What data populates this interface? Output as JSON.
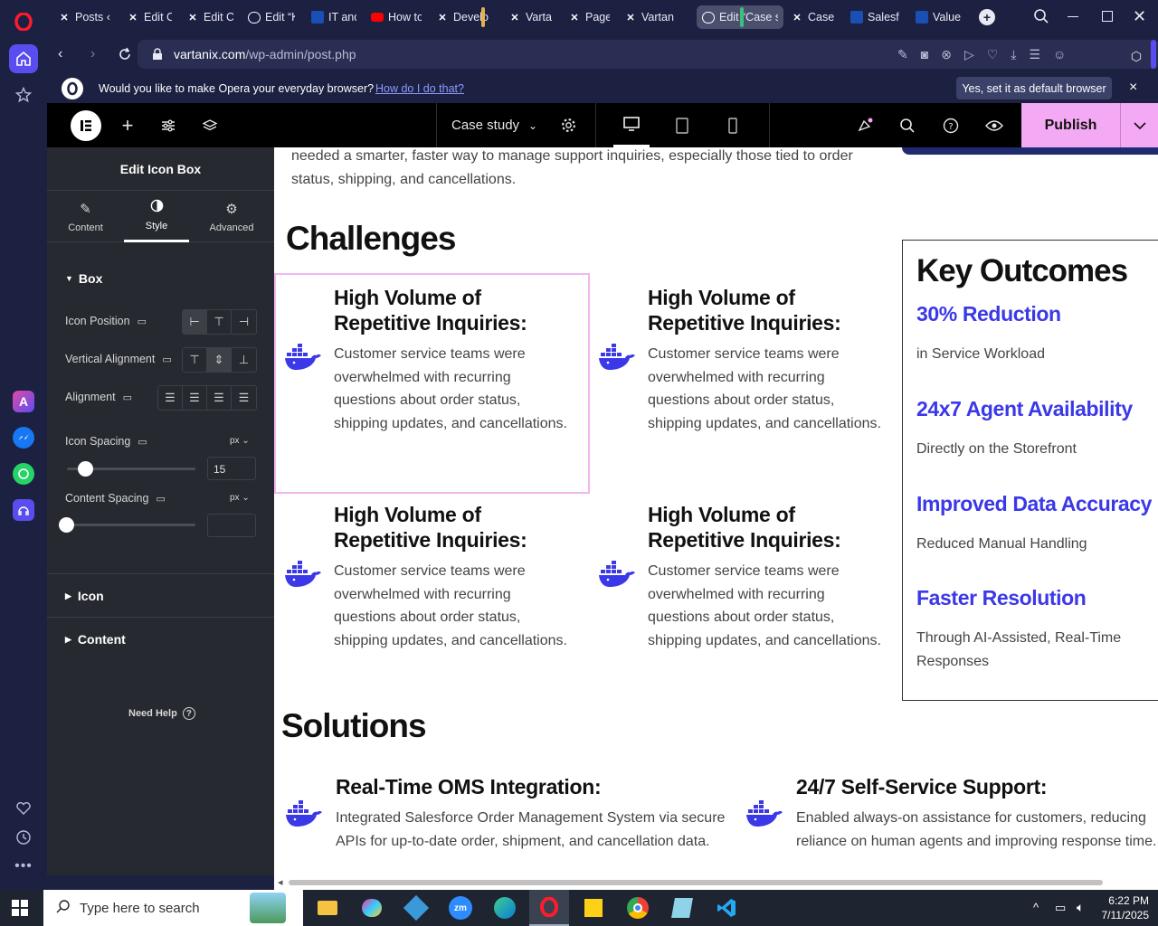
{
  "browser": {
    "tabs": [
      {
        "title": "Posts ‹",
        "icon": "x"
      },
      {
        "title": "Edit Co",
        "icon": "x"
      },
      {
        "title": "Edit Co",
        "icon": "x"
      },
      {
        "title": "Edit “K",
        "icon": "wp"
      },
      {
        "title": "IT and",
        "icon": "doc"
      },
      {
        "title": "How to",
        "icon": "yt"
      },
      {
        "title": "Develo",
        "icon": "x"
      },
      {
        "title": "Vartan",
        "icon": "x"
      },
      {
        "title": "Pages",
        "icon": "x"
      },
      {
        "title": "Vartan",
        "icon": "x"
      },
      {
        "title": "Edit “Case st",
        "icon": "wp"
      },
      {
        "title": "Case st",
        "icon": "x"
      },
      {
        "title": "Salesfo",
        "icon": "doc"
      },
      {
        "title": "Value c",
        "icon": "doc"
      }
    ],
    "url_domain": "vartanix.com",
    "url_path": "/wp-admin/post.php",
    "infobar": {
      "message": "Would you like to make Opera your everyday browser?",
      "link": "How do I do that?",
      "button": "Yes, set it as default browser",
      "close": "×"
    }
  },
  "elementor": {
    "document_title": "Case study",
    "publish_label": "Publish"
  },
  "panel": {
    "title": "Edit Icon Box",
    "tabs": [
      {
        "label": "Content",
        "icon": "pencil-icon"
      },
      {
        "label": "Style",
        "icon": "contrast-icon"
      },
      {
        "label": "Advanced",
        "icon": "gear-icon"
      }
    ],
    "active_tab": "Style",
    "section_box": "Box",
    "icon_position_label": "Icon Position",
    "vertical_alignment_label": "Vertical Alignment",
    "alignment_label": "Alignment",
    "icon_spacing_label": "Icon Spacing",
    "icon_spacing_unit": "px",
    "icon_spacing_value": "15",
    "content_spacing_label": "Content Spacing",
    "content_spacing_unit": "px",
    "content_spacing_value": "",
    "section_icon": "Icon",
    "section_content": "Content",
    "need_help": "Need Help"
  },
  "canvas": {
    "intro_text_line1": "needed a smarter, faster way to manage support inquiries, especially those tied to order",
    "intro_text_line2": "status, shipping, and cancellations.",
    "challenges_heading": "Challenges",
    "challenges": [
      {
        "title": "High Volume of Repetitive Inquiries:",
        "text": "Customer service teams were overwhelmed with recurring questions about order status, shipping updates, and cancellations."
      },
      {
        "title": "High Volume of Repetitive Inquiries:",
        "text": "Customer service teams were overwhelmed with recurring questions about order status, shipping updates, and cancellations."
      },
      {
        "title": "High Volume of Repetitive Inquiries:",
        "text": "Customer service teams were overwhelmed with recurring questions about order status, shipping updates, and cancellations."
      },
      {
        "title": "High Volume of Repetitive Inquiries:",
        "text": "Customer service teams were overwhelmed with recurring questions about order status, shipping updates, and cancellations."
      }
    ],
    "key_outcomes": {
      "heading": "Key Outcomes",
      "items": [
        {
          "title": "30% Reduction",
          "text": "in Service Workload"
        },
        {
          "title": "24x7 Agent Availability",
          "text": "Directly on the Storefront"
        },
        {
          "title": "Improved Data Accuracy",
          "text": "Reduced Manual Handling"
        },
        {
          "title": "Faster Resolution",
          "text": "Through AI-Assisted, Real-Time Responses"
        }
      ]
    },
    "solutions_heading": "Solutions",
    "solutions": [
      {
        "title": "Real-Time OMS Integration:",
        "text": "Integrated Salesforce Order Management System via secure APIs for up-to-date order, shipment, and cancellation data."
      },
      {
        "title": "24/7 Self-Service Support:",
        "text": "Enabled always-on assistance for customers, reducing reliance on human agents and improving response time."
      }
    ]
  },
  "taskbar": {
    "search_placeholder": "Type here to search",
    "time": "6:22 PM",
    "date": "7/11/2025"
  },
  "colors": {
    "accent_blue": "#3b38e8",
    "publish_pink": "#f4a9f4",
    "opera_red": "#ff1b2d",
    "selection_pink": "#f0b6f0"
  }
}
